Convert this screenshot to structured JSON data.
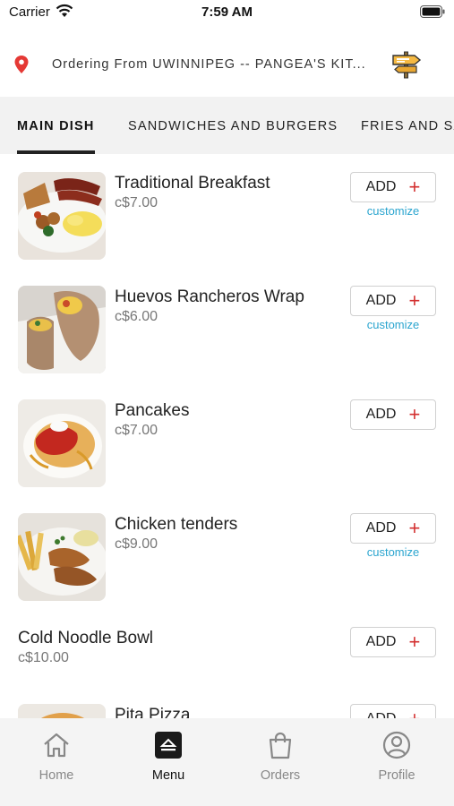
{
  "status_bar": {
    "carrier": "Carrier",
    "time": "7:59 AM",
    "icons": [
      "wifi-icon",
      "battery-icon"
    ]
  },
  "location": {
    "text": "Ordering From UWINNIPEG -- PANGEA'S KIT...",
    "pin_icon": "map-pin-icon",
    "action_icon": "signpost-icon",
    "pin_color": "#e53935"
  },
  "tabs": [
    {
      "label": "MAIN DISH",
      "active": true
    },
    {
      "label": "SANDWICHES AND BURGERS",
      "active": false
    },
    {
      "label": "FRIES AND SA",
      "active": false
    }
  ],
  "menu": {
    "add_label": "ADD",
    "customize_label": "customize",
    "accent_color": "#d32f2f",
    "link_color": "#2ba5cf",
    "items": [
      {
        "name": "Traditional Breakfast",
        "price": "c$7.00",
        "has_image": true,
        "customizable": true
      },
      {
        "name": "Huevos Rancheros Wrap",
        "price": "c$6.00",
        "has_image": true,
        "customizable": true
      },
      {
        "name": "Pancakes",
        "price": "c$7.00",
        "has_image": true,
        "customizable": false
      },
      {
        "name": "Chicken tenders",
        "price": "c$9.00",
        "has_image": true,
        "customizable": true
      },
      {
        "name": "Cold Noodle Bowl",
        "price": "c$10.00",
        "has_image": false,
        "customizable": false
      },
      {
        "name": "Pita Pizza",
        "price": "",
        "has_image": true,
        "customizable": false
      }
    ]
  },
  "bottom_nav": [
    {
      "label": "Home",
      "icon": "home-icon",
      "active": false
    },
    {
      "label": "Menu",
      "icon": "menu-icon",
      "active": true
    },
    {
      "label": "Orders",
      "icon": "shopping-bag-icon",
      "active": false
    },
    {
      "label": "Profile",
      "icon": "profile-icon",
      "active": false
    }
  ]
}
